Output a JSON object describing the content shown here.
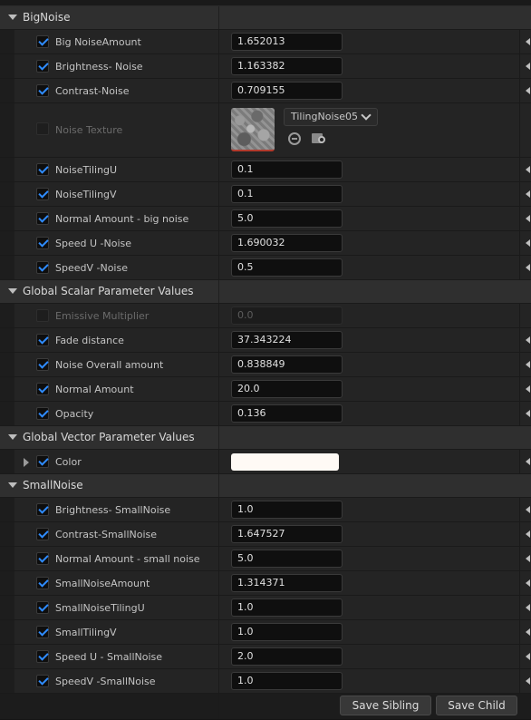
{
  "categories": {
    "big_noise": "BigNoise",
    "global_scalar": "Global Scalar Parameter Values",
    "global_vector": "Global Vector Parameter Values",
    "small_noise": "SmallNoise"
  },
  "big_noise": [
    {
      "label": "Big NoiseAmount",
      "value": "1.652013",
      "checked": true
    },
    {
      "label": "Brightness- Noise",
      "value": "1.163382",
      "checked": true
    },
    {
      "label": "Contrast-Noise",
      "value": "0.709155",
      "checked": true
    }
  ],
  "noise_texture": {
    "label": "Noise Texture",
    "checked": false,
    "asset": "TilingNoise05",
    "icons": [
      "use-selected-asset-icon",
      "browse-asset-icon"
    ]
  },
  "big_noise_2": [
    {
      "label": "NoiseTilingU",
      "value": "0.1",
      "checked": true
    },
    {
      "label": "NoiseTilingV",
      "value": "0.1",
      "checked": true
    },
    {
      "label": "Normal Amount - big noise",
      "value": "5.0",
      "checked": true
    },
    {
      "label": "Speed U -Noise",
      "value": "1.690032",
      "checked": true
    },
    {
      "label": "SpeedV -Noise",
      "value": "0.5",
      "checked": true
    }
  ],
  "global_scalar": [
    {
      "label": "Emissive Multiplier",
      "value": "0.0",
      "checked": false
    },
    {
      "label": "Fade distance",
      "value": "37.343224",
      "checked": true
    },
    {
      "label": "Noise Overall amount",
      "value": "0.838849",
      "checked": true
    },
    {
      "label": "Normal Amount",
      "value": "20.0",
      "checked": true
    },
    {
      "label": "Opacity",
      "value": "0.136",
      "checked": true
    }
  ],
  "global_vector": {
    "label": "Color",
    "checked": true,
    "color": "#fffaf5"
  },
  "small_noise": [
    {
      "label": "Brightness- SmallNoise",
      "value": "1.0",
      "checked": true
    },
    {
      "label": "Contrast-SmallNoise",
      "value": "1.647527",
      "checked": true
    },
    {
      "label": "Normal Amount - small noise",
      "value": "5.0",
      "checked": true
    },
    {
      "label": "SmallNoiseAmount",
      "value": "1.314371",
      "checked": true
    },
    {
      "label": "SmallNoiseTilingU",
      "value": "1.0",
      "checked": true
    },
    {
      "label": "SmallTilingV",
      "value": "1.0",
      "checked": true
    },
    {
      "label": "Speed U - SmallNoise",
      "value": "2.0",
      "checked": true
    },
    {
      "label": "SpeedV -SmallNoise",
      "value": "1.0",
      "checked": true
    }
  ],
  "footer": {
    "save_sibling": "Save Sibling",
    "save_child": "Save Child"
  },
  "colors": {
    "accent": "#2f8cff",
    "panel": "#242424",
    "header": "#2f2f2f"
  }
}
